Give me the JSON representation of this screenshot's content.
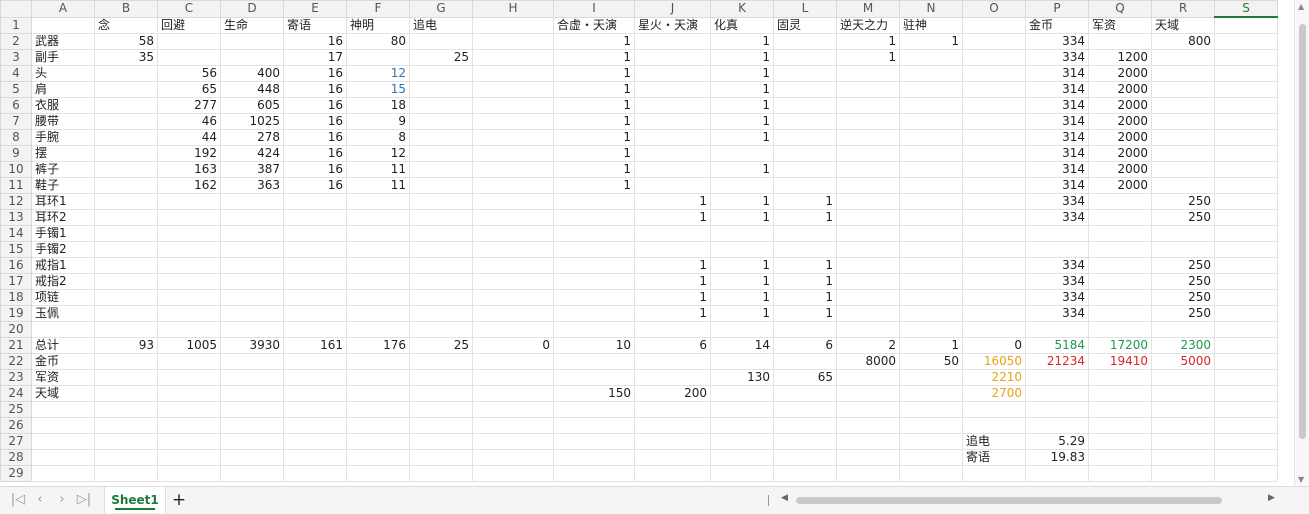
{
  "columns": [
    "A",
    "B",
    "C",
    "D",
    "E",
    "F",
    "G",
    "H",
    "I",
    "J",
    "K",
    "L",
    "M",
    "N",
    "O",
    "P",
    "Q",
    "R",
    "S"
  ],
  "active_column": "S",
  "rows": [
    {
      "n": "1",
      "c": {
        "B": "念",
        "C": "回避",
        "D": "生命",
        "E": "寄语",
        "F": "神明",
        "G": "追电",
        "I": "合虚・天演",
        "J": "星火・天演",
        "K": "化真",
        "L": "固灵",
        "M": "逆天之力",
        "N": "驻神",
        "P": "金币",
        "Q": "军资",
        "R": "天域"
      }
    },
    {
      "n": "2",
      "c": {
        "A": "武器",
        "B": "58",
        "E": "16",
        "F": "80",
        "I": "1",
        "K": "1",
        "M": "1",
        "N": "1",
        "P": "334",
        "R": "800"
      }
    },
    {
      "n": "3",
      "c": {
        "A": "副手",
        "B": "35",
        "E": "17",
        "G": "25",
        "I": "1",
        "K": "1",
        "M": "1",
        "P": "334",
        "Q": "1200"
      }
    },
    {
      "n": "4",
      "c": {
        "A": "头",
        "C": "56",
        "D": "400",
        "E": "16",
        "F": "12",
        "I": "1",
        "K": "1",
        "P": "314",
        "Q": "2000"
      }
    },
    {
      "n": "5",
      "c": {
        "A": "肩",
        "C": "65",
        "D": "448",
        "E": "16",
        "F": "15",
        "I": "1",
        "K": "1",
        "P": "314",
        "Q": "2000"
      }
    },
    {
      "n": "6",
      "c": {
        "A": "衣服",
        "C": "277",
        "D": "605",
        "E": "16",
        "F": "18",
        "I": "1",
        "K": "1",
        "P": "314",
        "Q": "2000"
      }
    },
    {
      "n": "7",
      "c": {
        "A": "腰带",
        "C": "46",
        "D": "1025",
        "E": "16",
        "F": "9",
        "I": "1",
        "K": "1",
        "P": "314",
        "Q": "2000"
      }
    },
    {
      "n": "8",
      "c": {
        "A": "手腕",
        "C": "44",
        "D": "278",
        "E": "16",
        "F": "8",
        "I": "1",
        "K": "1",
        "P": "314",
        "Q": "2000"
      }
    },
    {
      "n": "9",
      "c": {
        "A": "摆",
        "C": "192",
        "D": "424",
        "E": "16",
        "F": "12",
        "I": "1",
        "P": "314",
        "Q": "2000"
      }
    },
    {
      "n": "10",
      "c": {
        "A": "裤子",
        "C": "163",
        "D": "387",
        "E": "16",
        "F": "11",
        "I": "1",
        "K": "1",
        "P": "314",
        "Q": "2000"
      }
    },
    {
      "n": "11",
      "c": {
        "A": "鞋子",
        "C": "162",
        "D": "363",
        "E": "16",
        "F": "11",
        "I": "1",
        "P": "314",
        "Q": "2000"
      }
    },
    {
      "n": "12",
      "c": {
        "A": "耳环1",
        "J": "1",
        "K": "1",
        "L": "1",
        "P": "334",
        "R": "250"
      }
    },
    {
      "n": "13",
      "c": {
        "A": "耳环2",
        "J": "1",
        "K": "1",
        "L": "1",
        "P": "334",
        "R": "250"
      }
    },
    {
      "n": "14",
      "c": {
        "A": "手镯1"
      }
    },
    {
      "n": "15",
      "c": {
        "A": "手镯2"
      }
    },
    {
      "n": "16",
      "c": {
        "A": "戒指1",
        "J": "1",
        "K": "1",
        "L": "1",
        "P": "334",
        "R": "250"
      }
    },
    {
      "n": "17",
      "c": {
        "A": "戒指2",
        "J": "1",
        "K": "1",
        "L": "1",
        "P": "334",
        "R": "250"
      }
    },
    {
      "n": "18",
      "c": {
        "A": "项链",
        "J": "1",
        "K": "1",
        "L": "1",
        "P": "334",
        "R": "250"
      }
    },
    {
      "n": "19",
      "c": {
        "A": "玉佩",
        "J": "1",
        "K": "1",
        "L": "1",
        "P": "334",
        "R": "250"
      }
    },
    {
      "n": "20",
      "c": {}
    },
    {
      "n": "21",
      "c": {
        "A": "总计",
        "B": "93",
        "C": "1005",
        "D": "3930",
        "E": "161",
        "F": "176",
        "G": "25",
        "H": "0",
        "I": "10",
        "J": "6",
        "K": "14",
        "L": "6",
        "M": "2",
        "N": "1",
        "O": "0",
        "P": "5184",
        "Q": "17200",
        "R": "2300"
      }
    },
    {
      "n": "22",
      "c": {
        "A": "金币",
        "M": "8000",
        "N": "50",
        "O": "16050",
        "P": "21234",
        "Q": "19410",
        "R": "5000"
      }
    },
    {
      "n": "23",
      "c": {
        "A": "军资",
        "K": "130",
        "L": "65",
        "O": "2210"
      }
    },
    {
      "n": "24",
      "c": {
        "A": "天域",
        "I": "150",
        "J": "200",
        "O": "2700"
      }
    },
    {
      "n": "25",
      "c": {}
    },
    {
      "n": "26",
      "c": {}
    },
    {
      "n": "27",
      "c": {
        "O": "追电",
        "P": "5.29"
      }
    },
    {
      "n": "28",
      "c": {
        "O": "寄语",
        "P": "19.83"
      }
    },
    {
      "n": "29",
      "c": {}
    }
  ],
  "cell_colors": {
    "F4": "#2e75b6",
    "F5": "#2e75b6",
    "P21": "#1d9a4a",
    "Q21": "#1d9a4a",
    "R21": "#1d9a4a",
    "P22": "#d6262c",
    "Q22": "#d6262c",
    "R22": "#d6262c",
    "O22": "#e8a317",
    "O23": "#e8a317",
    "O24": "#e8a317"
  },
  "sheet_tabs": [
    {
      "label": "Sheet1",
      "active": true
    }
  ],
  "add_sheet_label": "+",
  "nav_icons": [
    "first-sheet-icon",
    "prev-sheet-icon",
    "next-sheet-icon",
    "last-sheet-icon"
  ]
}
